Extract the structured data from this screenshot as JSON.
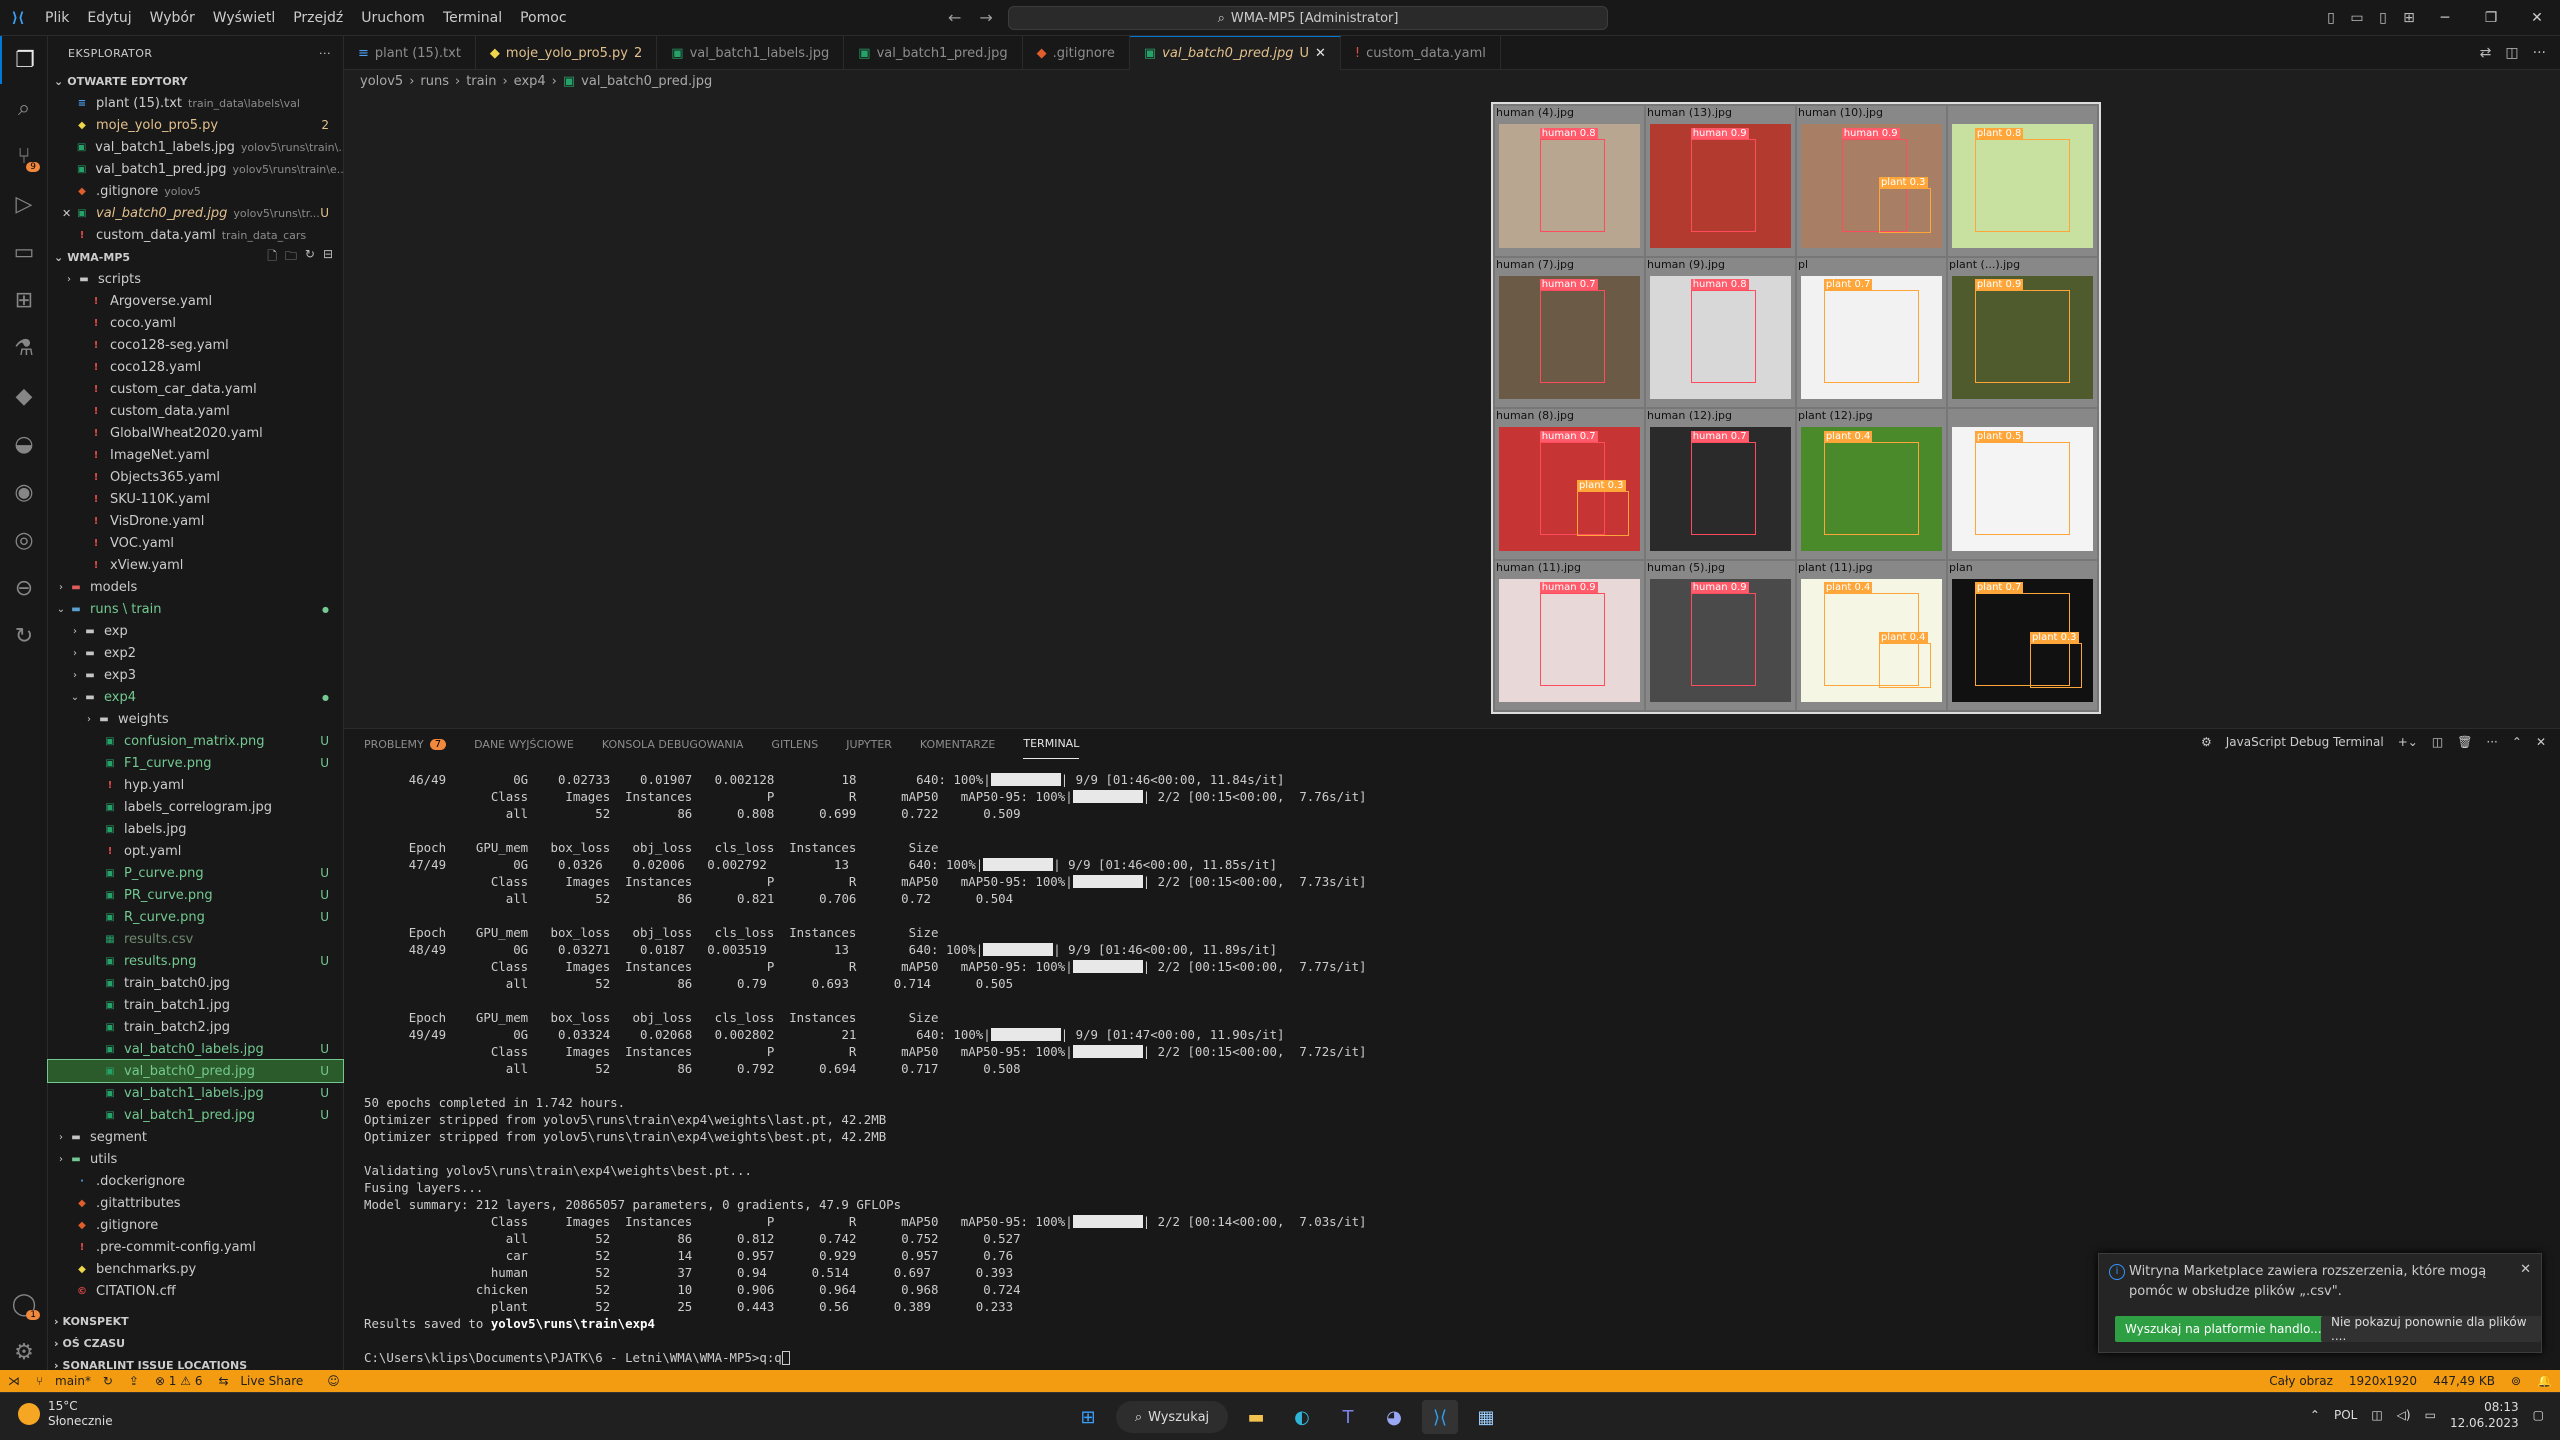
{
  "titlebar": {
    "menu": [
      "Plik",
      "Edytuj",
      "Wybór",
      "Wyświetl",
      "Przejdź",
      "Uruchom",
      "Terminal",
      "Pomoc"
    ],
    "search_text": "WMA-MP5 [Administrator]"
  },
  "sidebar": {
    "header": "EKSPLORATOR",
    "open_editors_title": "OTWARTE EDYTORY",
    "open_editors": [
      {
        "name": "plant (15).txt",
        "desc": "train_data\\labels\\val",
        "status": ""
      },
      {
        "name": "moje_yolo_pro5.py",
        "desc": "",
        "status": "2"
      },
      {
        "name": "val_batch1_labels.jpg",
        "desc": "yolov5\\runs\\train\\...",
        "status": ""
      },
      {
        "name": "val_batch1_pred.jpg",
        "desc": "yolov5\\runs\\train\\e...",
        "status": ""
      },
      {
        "name": ".gitignore",
        "desc": "yolov5",
        "status": ""
      },
      {
        "name": "val_batch0_pred.jpg",
        "desc": "yolov5\\runs\\tr...",
        "status": "U"
      },
      {
        "name": "custom_data.yaml",
        "desc": "train_data_cars",
        "status": ""
      }
    ],
    "project_title": "WMA-MP5",
    "tree": {
      "scripts": "scripts",
      "yamls": [
        "Argoverse.yaml",
        "coco.yaml",
        "coco128-seg.yaml",
        "coco128.yaml",
        "custom_car_data.yaml",
        "custom_data.yaml",
        "GlobalWheat2020.yaml",
        "ImageNet.yaml",
        "Objects365.yaml",
        "SKU-110K.yaml",
        "VisDrone.yaml",
        "VOC.yaml",
        "xView.yaml"
      ],
      "models": "models",
      "runs": "runs \\ train",
      "exps": [
        "exp",
        "exp2",
        "exp3"
      ],
      "exp4": "exp4",
      "weights": "weights",
      "exp4_files": [
        {
          "name": "confusion_matrix.png",
          "status": "U"
        },
        {
          "name": "F1_curve.png",
          "status": "U"
        },
        {
          "name": "hyp.yaml",
          "status": ""
        },
        {
          "name": "labels_correlogram.jpg",
          "status": ""
        },
        {
          "name": "labels.jpg",
          "status": ""
        },
        {
          "name": "opt.yaml",
          "status": ""
        },
        {
          "name": "P_curve.png",
          "status": "U"
        },
        {
          "name": "PR_curve.png",
          "status": "U"
        },
        {
          "name": "R_curve.png",
          "status": "U"
        },
        {
          "name": "results.csv",
          "status": ""
        },
        {
          "name": "results.png",
          "status": "U"
        },
        {
          "name": "train_batch0.jpg",
          "status": ""
        },
        {
          "name": "train_batch1.jpg",
          "status": ""
        },
        {
          "name": "train_batch2.jpg",
          "status": ""
        },
        {
          "name": "val_batch0_labels.jpg",
          "status": "U"
        },
        {
          "name": "val_batch0_pred.jpg",
          "status": "U"
        },
        {
          "name": "val_batch1_labels.jpg",
          "status": "U"
        },
        {
          "name": "val_batch1_pred.jpg",
          "status": "U"
        }
      ],
      "segment": "segment",
      "utils": "utils",
      "root_files": [
        ".dockerignore",
        ".gitattributes",
        ".gitignore",
        ".pre-commit-config.yaml",
        "benchmarks.py",
        "CITATION.cff"
      ]
    },
    "sections": [
      "KONSPEKT",
      "OŚ CZASU",
      "SONARLINT ISSUE LOCATIONS"
    ]
  },
  "tabs": [
    {
      "label": "plant (15).txt",
      "mod": ""
    },
    {
      "label": "moje_yolo_pro5.py",
      "mod": "2"
    },
    {
      "label": "val_batch1_labels.jpg",
      "mod": ""
    },
    {
      "label": "val_batch1_pred.jpg",
      "mod": ""
    },
    {
      "label": ".gitignore",
      "mod": ""
    },
    {
      "label": "val_batch0_pred.jpg",
      "mod": "U"
    },
    {
      "label": "custom_data.yaml",
      "mod": ""
    }
  ],
  "breadcrumb": [
    "yolov5",
    "runs",
    "train",
    "exp4",
    "val_batch0_pred.jpg"
  ],
  "mosaic": [
    {
      "label": "human (4).jpg",
      "tag": "human 0.8",
      "kind": "h",
      "bg": "#b8a690"
    },
    {
      "label": "human (13).jpg",
      "tag": "human 0.9",
      "kind": "h",
      "bg": "#b23a2e"
    },
    {
      "label": "human (10).jpg",
      "tag": "human 0.9",
      "kind": "h",
      "bg": "#a87f64",
      "tag2": "plant 0.3"
    },
    {
      "label": "",
      "tag": "plant 0.8",
      "kind": "p",
      "bg": "#c8e0a0"
    },
    {
      "label": "human (7).jpg",
      "tag": "human 0.7",
      "kind": "h",
      "bg": "#6b5a45"
    },
    {
      "label": "human (9).jpg",
      "tag": "human 0.8",
      "kind": "h",
      "bg": "#d8d8d8"
    },
    {
      "label": "pl",
      "tag": "plant 0.7",
      "kind": "p",
      "bg": "#f2f2f2"
    },
    {
      "label": "plant (...).jpg",
      "tag": "plant 0.9",
      "kind": "p",
      "bg": "#4f5b2c"
    },
    {
      "label": "human (8).jpg",
      "tag": "human 0.7",
      "kind": "h",
      "bg": "#c73434",
      "tag2": "plant 0.3"
    },
    {
      "label": "human (12).jpg",
      "tag": "human 0.7",
      "kind": "h",
      "bg": "#2a2a2a"
    },
    {
      "label": "plant (12).jpg",
      "tag": "plant 0.4",
      "kind": "p",
      "bg": "#4a8a2a"
    },
    {
      "label": "",
      "tag": "plant 0.5",
      "kind": "p",
      "bg": "#f4f4f4"
    },
    {
      "label": "human (11).jpg",
      "tag": "human 0.9",
      "kind": "h",
      "bg": "#e9d8d8"
    },
    {
      "label": "human (5).jpg",
      "tag": "human 0.9",
      "kind": "h",
      "bg": "#4a4a4a"
    },
    {
      "label": "plant (11).jpg",
      "tag": "plant 0.4",
      "kind": "p",
      "bg": "#f6f6e4",
      "tag2": "plant 0.4"
    },
    {
      "label": "plan",
      "tag": "plant 0.7",
      "kind": "p",
      "bg": "#111111",
      "tag2": "plant 0.3"
    }
  ],
  "panel": {
    "tabs": [
      {
        "label": "PROBLEMY",
        "count": "7"
      },
      {
        "label": "DANE WYJŚCIOWE",
        "count": ""
      },
      {
        "label": "KONSOLA DEBUGOWANIA",
        "count": ""
      },
      {
        "label": "GITLENS",
        "count": ""
      },
      {
        "label": "JUPYTER",
        "count": ""
      },
      {
        "label": "KOMENTARZE",
        "count": ""
      },
      {
        "label": "TERMINAL",
        "count": ""
      }
    ],
    "terminal_name": "JavaScript Debug Terminal"
  },
  "terminal": {
    "epochs": [
      {
        "epoch": "46/49",
        "gpu": "0G",
        "box": "0.02733",
        "obj": "0.01907",
        "cls": "0.002128",
        "inst": "18",
        "size": "640",
        "speed": "9/9 [01:46<00:00, 11.84s/it]",
        "val_speed": "2/2 [00:15<00:00,  7.76s/it]",
        "p": "0.808",
        "r": "0.699",
        "map50": "0.722",
        "map": "0.509",
        "header": false
      },
      {
        "epoch": "47/49",
        "gpu": "0G",
        "box": "0.0326",
        "obj": "0.02006",
        "cls": "0.002792",
        "inst": "13",
        "size": "640",
        "speed": "9/9 [01:46<00:00, 11.85s/it]",
        "val_speed": "2/2 [00:15<00:00,  7.73s/it]",
        "p": "0.821",
        "r": "0.706",
        "map50": "0.72",
        "map": "0.504",
        "header": true
      },
      {
        "epoch": "48/49",
        "gpu": "0G",
        "box": "0.03271",
        "obj": "0.0187",
        "cls": "0.003519",
        "inst": "13",
        "size": "640",
        "speed": "9/9 [01:46<00:00, 11.89s/it]",
        "val_speed": "2/2 [00:15<00:00,  7.77s/it]",
        "p": "0.79",
        "r": "0.693",
        "map50": "0.714",
        "map": "0.505",
        "header": true
      },
      {
        "epoch": "49/49",
        "gpu": "0G",
        "box": "0.03324",
        "obj": "0.02068",
        "cls": "0.002802",
        "inst": "21",
        "size": "640",
        "speed": "9/9 [01:47<00:00, 11.90s/it]",
        "val_speed": "2/2 [00:15<00:00,  7.72s/it]",
        "p": "0.792",
        "r": "0.694",
        "map50": "0.717",
        "map": "0.508",
        "header": true
      }
    ],
    "images": "52",
    "instances": "86",
    "summary_lines": [
      "50 epochs completed in 1.742 hours.",
      "Optimizer stripped from yolov5\\runs\\train\\exp4\\weights\\last.pt, 42.2MB",
      "Optimizer stripped from yolov5\\runs\\train\\exp4\\weights\\best.pt, 42.2MB",
      "",
      "Validating yolov5\\runs\\train\\exp4\\weights\\best.pt...",
      "Fusing layers...",
      "Model summary: 212 layers, 20865057 parameters, 0 gradients, 47.9 GFLOPs"
    ],
    "final_speed": "2/2 [00:14<00:00,  7.03s/it]",
    "final": [
      {
        "cls": "all",
        "img": "52",
        "inst": "86",
        "p": "0.812",
        "r": "0.742",
        "m50": "0.752",
        "m": "0.527"
      },
      {
        "cls": "car",
        "img": "52",
        "inst": "14",
        "p": "0.957",
        "r": "0.929",
        "m50": "0.957",
        "m": "0.76"
      },
      {
        "cls": "human",
        "img": "52",
        "inst": "37",
        "p": "0.94",
        "r": "0.514",
        "m50": "0.697",
        "m": "0.393"
      },
      {
        "cls": "chicken",
        "img": "52",
        "inst": "10",
        "p": "0.906",
        "r": "0.964",
        "m50": "0.968",
        "m": "0.724"
      },
      {
        "cls": "plant",
        "img": "52",
        "inst": "25",
        "p": "0.443",
        "r": "0.56",
        "m50": "0.389",
        "m": "0.233"
      }
    ],
    "saved_prefix": "Results saved to ",
    "saved_path": "yolov5\\runs\\train\\exp4",
    "prompt": "C:\\Users\\klips\\Documents\\PJATK\\6 - Letni\\WMA\\WMA-MP5>q:q"
  },
  "notification": {
    "message": "Witryna Marketplace zawiera rozszerzenia, które mogą pomóc w obsłudze plików „.csv\".",
    "primary": "Wyszukaj na platformie handlo...",
    "secondary": "Nie pokazuj ponownie dla plików ...."
  },
  "statusbar": {
    "branch": "main*",
    "problems": "⊗ 1 ⚠ 6",
    "live_share": "Live Share",
    "right": [
      "Cały obraz",
      "1920x1920",
      "447,49 KB"
    ]
  },
  "taskbar": {
    "temp": "15°C",
    "weather": "Słonecznie",
    "search": "Wyszukaj",
    "lang": "POL",
    "time": "08:13",
    "date": "12.06.2023"
  },
  "colors": {
    "accent": "#0078d4",
    "status": "#f39c12",
    "human_box": "#ff4b5c",
    "plant_box": "#ffa63a"
  }
}
